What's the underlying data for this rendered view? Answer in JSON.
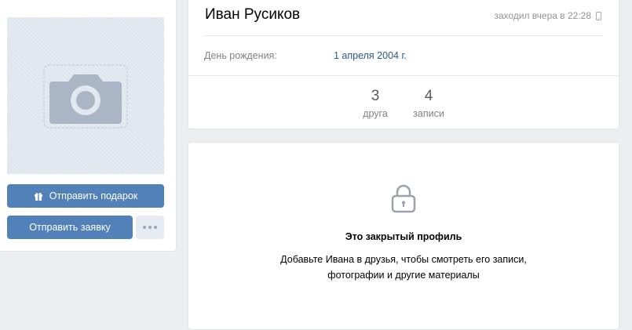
{
  "profile": {
    "name": "Иван Русиков",
    "last_seen": "заходил вчера в 22:28",
    "birthday_label": "День рождения:",
    "birthday_value": "1 апреля 2004 г."
  },
  "counters": [
    {
      "value": "3",
      "label": "друга"
    },
    {
      "value": "4",
      "label": "записи"
    }
  ],
  "actions": {
    "gift_label": "Отправить подарок",
    "request_label": "Отправить заявку"
  },
  "private": {
    "title": "Это закрытый профиль",
    "line1": "Добавьте Ивана в друзья, чтобы смотреть его записи,",
    "line2": "фотографии и другие материалы"
  },
  "icons": {
    "avatar": "camera-icon",
    "gift": "gift-icon",
    "more": "more-dots-icon",
    "device": "phone-icon",
    "private": "lock-icon"
  },
  "colors": {
    "accent": "#5181b8",
    "link": "#2a5885",
    "background": "#edeef0"
  }
}
